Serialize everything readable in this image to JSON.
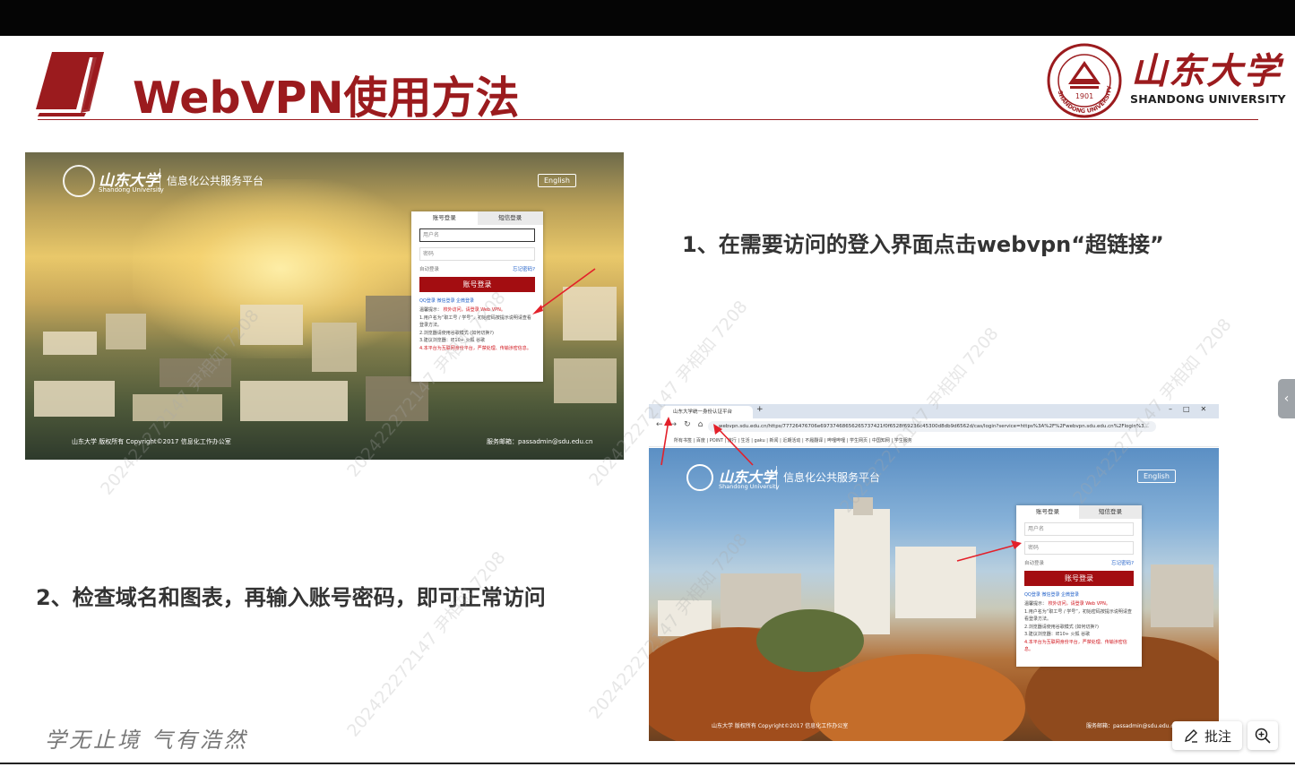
{
  "slide": {
    "title": "WebVPN使用方法",
    "step1": "1、在需要访问的登入界面点击webvpn“超链接”",
    "step2": "2、检查域名和图表，再输入账号密码，即可正常访问",
    "motto": "学无止境 气有浩然",
    "watermark": "202422272147 尹相如 7208"
  },
  "logo": {
    "name_cn": "山东大学",
    "name_en": "SHANDONG UNIVERSITY",
    "seal_year": "1901",
    "seal_text": "SHANDONG UNIVERSITY"
  },
  "screenshot1": {
    "brand": "山东大学",
    "brand_sub": "Shandong University",
    "platform": "信息化公共服务平台",
    "english_btn": "English",
    "tab_account": "账号登录",
    "tab_sms": "短信登录",
    "username_placeholder": "用户名",
    "password_placeholder": "密码",
    "auto_login": "自动登录",
    "forgot": "忘记密码?",
    "login_btn": "账号登录",
    "social": "QQ登录   微信登录   企微登录",
    "note_title": "温馨提示：",
    "note_offcampus": "校外访问，请登录 Web VPN。",
    "note1": "1.用户名为“职工号 / 学号”，初始密码按提示说明请查看登录方法。",
    "note2": "2.浏览器请使用谷歌模式 (如何切换?)",
    "note3": "3.建议浏览器：IE10+  火狐  谷歌",
    "note4": "4.本平台为互联网身份平台，严禁处理、传输涉密信息。",
    "footer_left": "山东大学 版权所有 Copyright©2017 信息化工作办公室",
    "footer_right": "服务邮箱：passadmin@sdu.edu.cn"
  },
  "screenshot2": {
    "tab_title": "山东大学统一身份认证平台",
    "url": "webvpn.sdu.edu.cn/https/77726476706e69737468656265737421f0f6528f69236c45300d8db9d6562d/cas/login?service=https%3A%2F%2Fwebvpn.sdu.edu.cn%2Flogin%3...",
    "bookmarks": "所有书签 | 百度 | POINT | 旅行 | 生活 | gaku | 新闻 | 近期活动 | 不履翻译 | 哔哩哔哩 | 学生网页 | 中国知网 | 学生服务",
    "brand": "山东大学",
    "brand_sub": "Shandong University",
    "platform": "信息化公共服务平台",
    "english_btn": "English",
    "tab_account": "账号登录",
    "tab_sms": "短信登录",
    "username_placeholder": "用户名",
    "password_placeholder": "密码",
    "auto_login": "自动登录",
    "forgot": "忘记密码?",
    "login_btn": "账号登录",
    "social": "QQ登录   微信登录   企微登录",
    "note_title": "温馨提示：",
    "note_offcampus": "校外访问，请登录 Web VPN。",
    "note1": "1.用户名为“职工号 / 学号”，初始密码按提示说明请查看登录方法。",
    "note2": "2.浏览器请使用谷歌模式 (如何切换?)",
    "note3": "3.建议浏览器：IE10+  火狐  谷歌",
    "note4": "4.本平台为互联网身份平台，严禁处理、传输涉密信息。",
    "footer_left": "山东大学 版权所有 Copyright©2017 信息化工作办公室",
    "footer_right": "服务邮箱：passadmin@sdu.edu.cn"
  },
  "viewer": {
    "annotate_label": "批注",
    "side_tab_icon": "chevron-left-icon",
    "zoom_icon": "zoom-in-icon",
    "annotate_icon": "pen-icon"
  },
  "colors": {
    "brand_red": "#9b1b1e",
    "login_red": "#a30d11",
    "link_blue": "#1f5fc8"
  }
}
